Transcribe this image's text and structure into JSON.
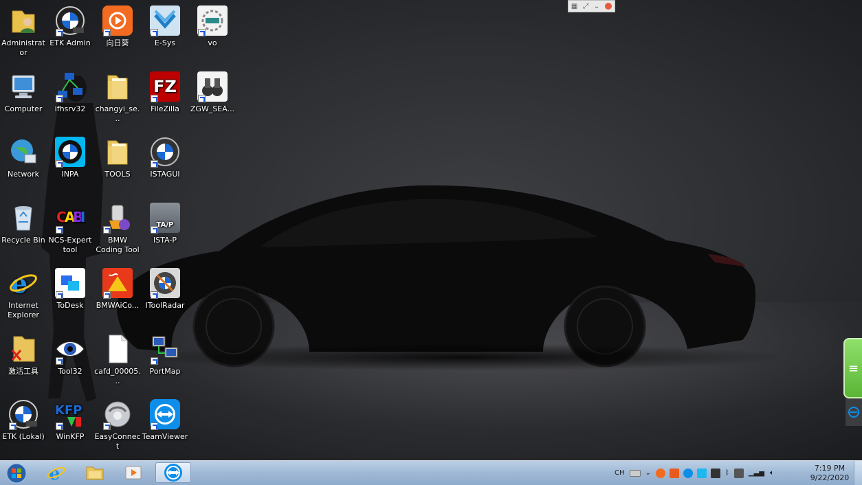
{
  "desktop": {
    "icons": [
      {
        "label": "Administrator",
        "icon": "user-folder-icon"
      },
      {
        "label": "ETK Admin",
        "icon": "bmw-etk-admin-icon"
      },
      {
        "label": "向日葵",
        "icon": "sunflower-icon"
      },
      {
        "label": "E-Sys",
        "icon": "esys-icon"
      },
      {
        "label": "vo",
        "icon": "vo-app-icon"
      },
      {
        "label": "Computer",
        "icon": "computer-icon"
      },
      {
        "label": "ifhsrv32",
        "icon": "network-server-icon"
      },
      {
        "label": "changyi_se...",
        "icon": "folder-icon"
      },
      {
        "label": "FileZilla",
        "icon": "filezilla-icon"
      },
      {
        "label": "ZGW_SEA...",
        "icon": "binoculars-icon"
      },
      {
        "label": "Network",
        "icon": "network-globe-icon"
      },
      {
        "label": "INPA",
        "icon": "bmw-inpa-icon"
      },
      {
        "label": "TOOLS",
        "icon": "folder-icon"
      },
      {
        "label": "ISTAGUI",
        "icon": "bmw-logo-icon"
      },
      {
        "label": "Recycle Bin",
        "icon": "recycle-bin-icon"
      },
      {
        "label": "NCS-Expert tool",
        "icon": "ncs-expert-icon"
      },
      {
        "label": "BMW Coding Tool",
        "icon": "coding-tool-icon"
      },
      {
        "label": "ISTA-P",
        "icon": "ista-p-icon"
      },
      {
        "label": "Internet Explorer",
        "icon": "internet-explorer-icon"
      },
      {
        "label": "ToDesk",
        "icon": "todesk-icon"
      },
      {
        "label": "BMWAiCo...",
        "icon": "bmw-aico-icon"
      },
      {
        "label": "IToolRadar",
        "icon": "itoolradar-icon"
      },
      {
        "label": "激活工具",
        "icon": "activation-tool-icon"
      },
      {
        "label": "Tool32",
        "icon": "eye-icon"
      },
      {
        "label": "cafd_00005...",
        "icon": "blank-file-icon"
      },
      {
        "label": "PortMap",
        "icon": "portmap-icon"
      },
      {
        "label": "ETK (Lokal)",
        "icon": "bmw-etk-lokal-icon"
      },
      {
        "label": "WinKFP",
        "icon": "winkfp-icon"
      },
      {
        "label": "EasyConnect",
        "icon": "easyconnect-icon"
      },
      {
        "label": "TeamViewer",
        "icon": "teamviewer-icon"
      }
    ]
  },
  "taskbar": {
    "pinned": [
      "internet-explorer-icon",
      "file-explorer-icon",
      "media-player-icon",
      "teamviewer-icon"
    ],
    "tray": {
      "language": "CH",
      "icons": [
        "keyboard-icon",
        "chevron-icon",
        "sunflower-tray-icon",
        "app-tray-icon",
        "teamviewer-tray-icon",
        "todesk-tray-icon",
        "network-tray-icon",
        "bluetooth-icon",
        "device-icon",
        "signal-icon",
        "volume-icon"
      ]
    },
    "clock": {
      "time": "7:19 PM",
      "date": "9/22/2020"
    }
  },
  "remote_toolbar": {
    "icons": [
      "grid-icon",
      "fullscreen-icon",
      "chevron-down-icon",
      "record-icon"
    ]
  },
  "colors": {
    "taskbar": "#a9c1dc",
    "bmw_blue": "#1c69d4",
    "record": "#e55b3c"
  }
}
